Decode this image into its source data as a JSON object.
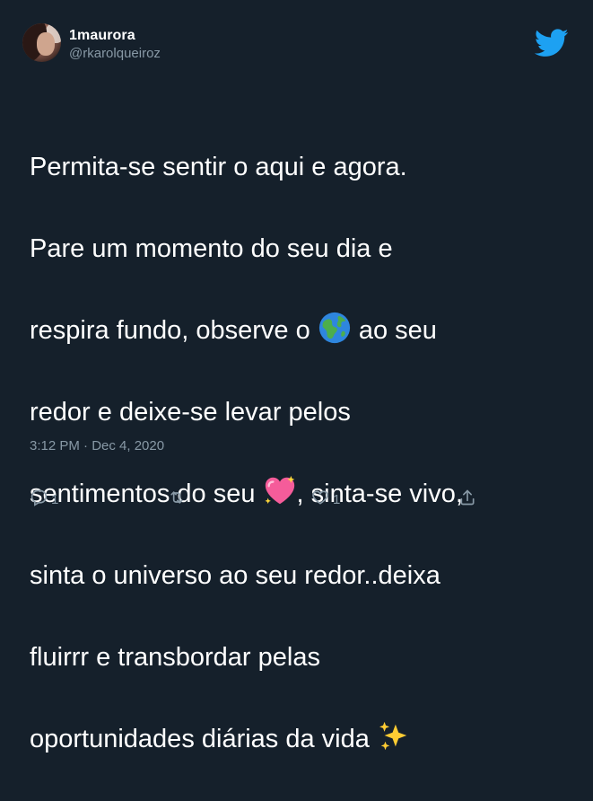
{
  "user": {
    "name": "1maurora",
    "handle": "@rkarolqueiroz"
  },
  "tweet": {
    "lines": [
      "Permita-se sentir o aqui e agora.",
      "Pare um momento do seu dia e",
      [
        "respira fundo, observe o ",
        "globe-emoji",
        " ao seu"
      ],
      "redor e deixe-se levar pelos",
      [
        "sentimentos do seu ",
        "sparkling-heart-emoji",
        ", sinta-se vivo,"
      ],
      "sinta o universo ao seu redor..deixa",
      "fluirrr e transbordar pelas",
      [
        "oportunidades diárias da vida  ",
        "sparkles-emoji"
      ]
    ],
    "line1": "Permita-se sentir o aqui e agora.",
    "line2": "Pare um momento do seu dia e",
    "line3_a": "respira fundo, observe o ",
    "line3_b": " ao seu",
    "line4": "redor e deixe-se levar pelos",
    "line5_a": "sentimentos do seu ",
    "line5_b": ", sinta-se vivo,",
    "line6": "sinta o universo ao seu redor..deixa",
    "line7": "fluirrr e transbordar pelas",
    "line8": "oportunidades diárias da vida  ",
    "timestamp": "3:12 PM · Dec 4, 2020"
  },
  "actions": {
    "reply_count": "1",
    "like_count": "1"
  },
  "icons": {
    "logo": "twitter-bird-icon",
    "reply": "reply-icon",
    "retweet": "retweet-icon",
    "like": "heart-icon",
    "share": "share-icon"
  },
  "colors": {
    "background": "#15202b",
    "text": "#ffffff",
    "secondary": "#8899a6",
    "brand": "#1da1f2"
  }
}
